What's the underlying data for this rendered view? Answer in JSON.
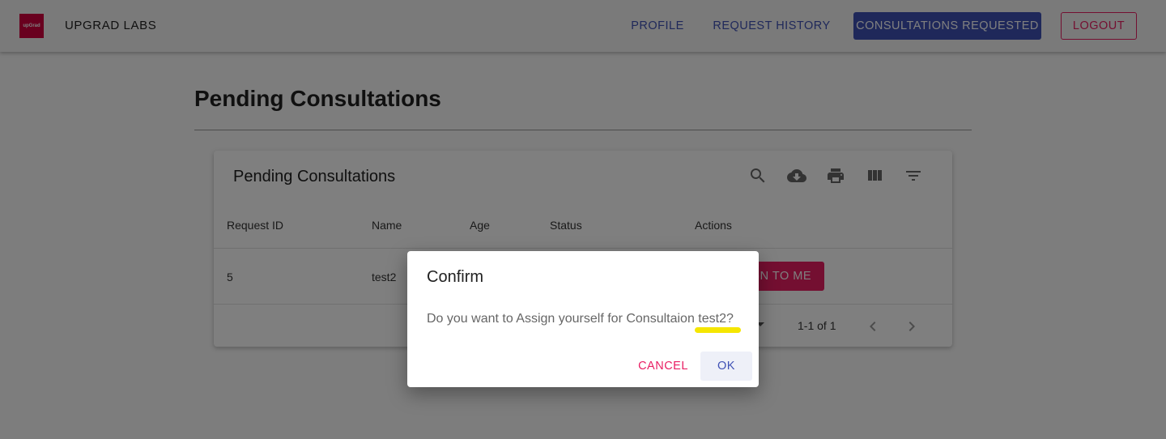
{
  "app": {
    "logo_text": "upGrad",
    "brand": "UPGRAD LABS"
  },
  "nav": {
    "profile": "PROFILE",
    "history": "REQUEST HISTORY",
    "consultations": "CONSULTATIONS REQUESTED",
    "logout": "LOGOUT"
  },
  "page": {
    "title": "Pending Consultations"
  },
  "table": {
    "title": "Pending Consultations",
    "toolbar_icons": [
      "search-icon",
      "download-icon",
      "print-icon",
      "view-columns-icon",
      "filter-icon"
    ],
    "columns": [
      "Request ID",
      "Name",
      "Age",
      "Status",
      "Actions"
    ],
    "rows": [
      {
        "request_id": "5",
        "name": "test2",
        "assign_label": "GN TO ME"
      }
    ],
    "pagination": "1-1 of 1"
  },
  "dialog": {
    "title": "Confirm",
    "message": "Do you want to Assign yourself for Consultaion test2?",
    "cancel": "CANCEL",
    "ok": "OK"
  },
  "colors": {
    "primary": "#3f51b5",
    "secondary": "#e91e63",
    "highlight": "#f5e600"
  }
}
